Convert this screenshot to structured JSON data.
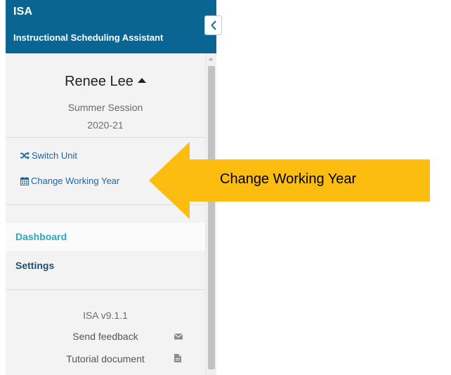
{
  "app": {
    "title": "ISA",
    "subtitle": "Instructional Scheduling Assistant"
  },
  "user": {
    "name": "Renee Lee",
    "session": "Summer Session",
    "year": "2020-21"
  },
  "actions": {
    "switch_unit": "Switch Unit",
    "change_working_year": "Change Working Year"
  },
  "nav": {
    "dashboard": "Dashboard",
    "settings": "Settings"
  },
  "footer": {
    "version": "ISA v9.1.1",
    "send_feedback": "Send feedback",
    "tutorial_document": "Tutorial document"
  },
  "callout": {
    "label": "Change Working Year"
  },
  "colors": {
    "header_bg": "#0a6593",
    "link": "#1a66a6",
    "active_nav": "#27a9c2",
    "nav": "#1e4e6b",
    "callout_arrow": "#fdbd10"
  },
  "icons": {
    "collapse": "chevron-left-icon",
    "switch_unit": "shuffle-icon",
    "change_working_year": "calendar-icon",
    "user_menu": "caret-up-icon",
    "send_feedback": "envelope-icon",
    "tutorial_document": "file-icon"
  }
}
